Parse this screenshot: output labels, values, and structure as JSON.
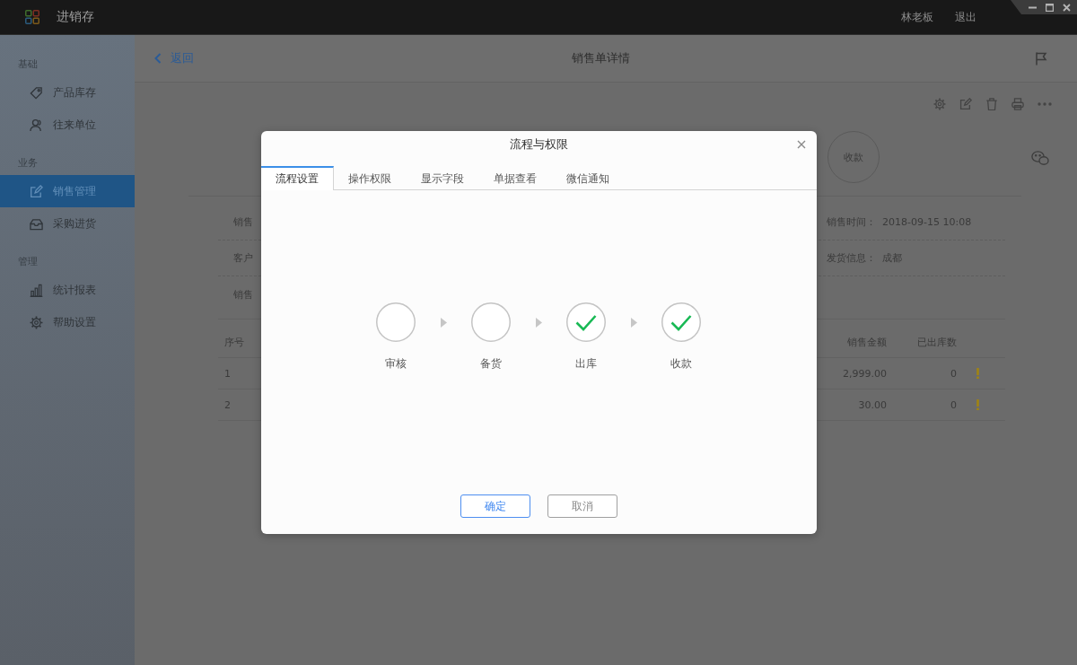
{
  "app": {
    "title": "进销存",
    "user": "林老板",
    "logout": "退出"
  },
  "sidebar": {
    "sections": [
      {
        "label": "基础",
        "items": [
          {
            "label": "产品库存",
            "selected": false
          },
          {
            "label": "往来单位",
            "selected": false
          }
        ]
      },
      {
        "label": "业务",
        "items": [
          {
            "label": "销售管理",
            "selected": true
          },
          {
            "label": "采购进货",
            "selected": false
          }
        ]
      },
      {
        "label": "管理",
        "items": [
          {
            "label": "统计报表",
            "selected": false
          },
          {
            "label": "帮助设置",
            "selected": false
          }
        ]
      }
    ]
  },
  "page": {
    "back": "返回",
    "title": "销售单详情",
    "status_steps": [
      {
        "label": "收款"
      }
    ]
  },
  "details": {
    "rows": [
      {
        "label": "销售",
        "right_label": "销售时间：",
        "right_value": "2018-09-15 10:08"
      },
      {
        "label": "客户",
        "right_label": "发货信息：",
        "right_value": "成都"
      },
      {
        "label": "销售"
      }
    ]
  },
  "table": {
    "columns": {
      "index": "序号",
      "amount": "销售金额",
      "shipped": "已出库数"
    },
    "rows": [
      {
        "index": "1",
        "amount": "2,999.00",
        "shipped": "0",
        "warning": true
      },
      {
        "index": "2",
        "amount": "30.00",
        "shipped": "0",
        "warning": true
      }
    ]
  },
  "dialog": {
    "title": "流程与权限",
    "tabs": [
      {
        "label": "流程设置",
        "selected": true
      },
      {
        "label": "操作权限",
        "selected": false
      },
      {
        "label": "显示字段",
        "selected": false
      },
      {
        "label": "单据查看",
        "selected": false
      },
      {
        "label": "微信通知",
        "selected": false
      }
    ],
    "steps": [
      {
        "label": "审核",
        "done": false
      },
      {
        "label": "备货",
        "done": false
      },
      {
        "label": "出库",
        "done": true
      },
      {
        "label": "收款",
        "done": true
      }
    ],
    "buttons": [
      {
        "label": "确定",
        "kind": "primary"
      },
      {
        "label": "取消",
        "kind": "secondary"
      }
    ]
  }
}
